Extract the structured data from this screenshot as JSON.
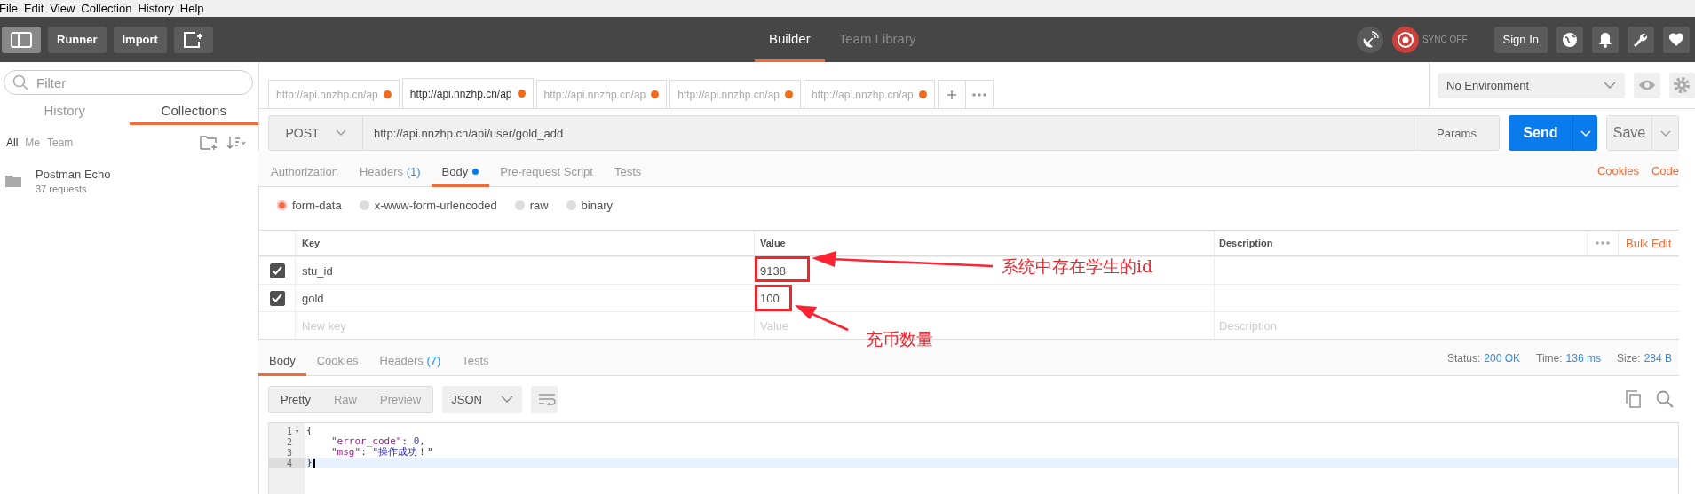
{
  "menu_bar": [
    "File",
    "Edit",
    "View",
    "Collection",
    "History",
    "Help"
  ],
  "header": {
    "buttons": [
      "Runner",
      "Import"
    ],
    "nav_tabs": [
      {
        "label": "Builder",
        "selected": true
      },
      {
        "label": "Team Library",
        "selected": false
      }
    ],
    "sync_status": "SYNC OFF",
    "sign_in": "Sign In"
  },
  "sidebar": {
    "filter_placeholder": "Filter",
    "tabs": [
      {
        "label": "History",
        "selected": false
      },
      {
        "label": "Collections",
        "selected": true
      }
    ],
    "filters": [
      {
        "label": "All",
        "selected": true
      },
      {
        "label": "Me",
        "selected": false
      },
      {
        "label": "Team",
        "selected": false
      }
    ],
    "collections": [
      {
        "name": "Postman Echo",
        "count": "37 requests"
      }
    ]
  },
  "request_tabs": [
    {
      "label": "http://api.nnzhp.cn/ap",
      "selected": false
    },
    {
      "label": "http://api.nnzhp.cn/ap",
      "selected": true
    },
    {
      "label": "http://api.nnzhp.cn/ap",
      "selected": false
    },
    {
      "label": "http://api.nnzhp.cn/ap",
      "selected": false
    },
    {
      "label": "http://api.nnzhp.cn/ap",
      "selected": false
    }
  ],
  "environment": "No Environment",
  "request": {
    "method": "POST",
    "url": "http://api.nnzhp.cn/api/user/gold_add",
    "params": "Params",
    "send": "Send",
    "save": "Save"
  },
  "request_sections": [
    {
      "label": "Authorization",
      "selected": false
    },
    {
      "label": "Headers",
      "count": "(1)",
      "selected": false
    },
    {
      "label": "Body",
      "selected": true,
      "dot": true
    },
    {
      "label": "Pre-request Script",
      "selected": false
    },
    {
      "label": "Tests",
      "selected": false
    }
  ],
  "request_links": [
    "Cookies",
    "Code"
  ],
  "body_modes": [
    {
      "label": "form-data",
      "selected": true
    },
    {
      "label": "x-www-form-urlencoded",
      "selected": false
    },
    {
      "label": "raw",
      "selected": false
    },
    {
      "label": "binary",
      "selected": false
    }
  ],
  "params_table": {
    "columns": [
      "Key",
      "Value",
      "Description"
    ],
    "bulk_edit": "Bulk Edit",
    "rows": [
      {
        "key": "stu_id",
        "value": "9138",
        "checked": true,
        "highlighted": true
      },
      {
        "key": "gold",
        "value": "100",
        "checked": true,
        "highlighted": true
      }
    ],
    "new_row": {
      "key": {
        "placeholder": "New key"
      },
      "value": {
        "placeholder": "Value"
      },
      "description": {
        "placeholder": "Description"
      }
    }
  },
  "annotations": [
    {
      "text": "系统中存在学生的id"
    },
    {
      "text": "充币数量"
    }
  ],
  "response": {
    "tabs": [
      {
        "label": "Body",
        "selected": true
      },
      {
        "label": "Cookies",
        "selected": false
      },
      {
        "label": "Headers",
        "count": "(7)",
        "selected": false
      },
      {
        "label": "Tests",
        "selected": false
      }
    ],
    "status": [
      {
        "label": "Status:",
        "value": "200 OK"
      },
      {
        "label": "Time:",
        "value": "136 ms"
      },
      {
        "label": "Size:",
        "value": "284 B"
      }
    ],
    "views": [
      {
        "label": "Pretty",
        "selected": true
      },
      {
        "label": "Raw",
        "selected": false
      },
      {
        "label": "Preview",
        "selected": false
      }
    ],
    "format": "JSON",
    "code_lines": [
      {
        "number": "1",
        "fold_marker": "▾",
        "current": false,
        "indented": false,
        "tokens": [
          {
            "kind": "punct",
            "text": "{"
          }
        ]
      },
      {
        "number": "2",
        "current": false,
        "indented": true,
        "tokens": [
          {
            "kind": "key",
            "text": "\"error_code\""
          },
          {
            "kind": "punct",
            "text": ": "
          },
          {
            "kind": "number",
            "text": "0"
          },
          {
            "kind": "punct",
            "text": ","
          }
        ]
      },
      {
        "number": "3",
        "current": false,
        "indented": true,
        "tokens": [
          {
            "kind": "key",
            "text": "\"msg\""
          },
          {
            "kind": "punct",
            "text": ": "
          },
          {
            "kind": "string",
            "text": "\"操作成功！\""
          }
        ]
      },
      {
        "number": "4",
        "current": true,
        "indented": false,
        "tokens": [
          {
            "kind": "punct",
            "text": "}"
          }
        ]
      }
    ]
  }
}
